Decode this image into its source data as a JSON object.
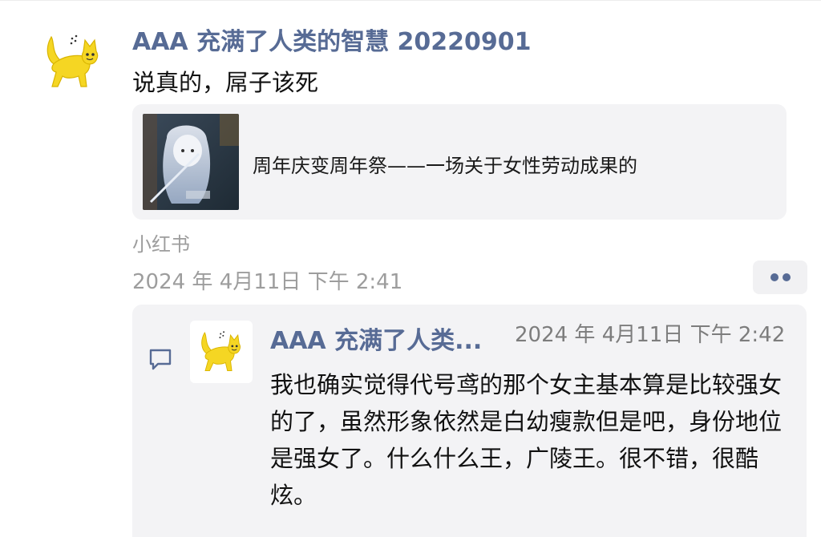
{
  "post": {
    "author": "AAA 充满了人类的智慧 20220901",
    "text": "说真的，屌子该死",
    "share": {
      "title": "周年庆变周年祭——一场关于女性劳动成果的",
      "source": "小红书"
    },
    "timestamp": "2024 年 4月11日 下午 2:41"
  },
  "comment": {
    "author": "AAA 充满了人类...",
    "time": "2024 年 4月11日 下午 2:42",
    "text": "我也确实觉得代号鸢的那个女主基本算是比较强女的了，虽然形象依然是白幼瘦款但是吧，身份地位是强女了。什么什么王，广陵王。很不错，很酷炫。"
  },
  "icons": {
    "avatar": "yellow-cat-icon",
    "more": "more-dots-icon",
    "comment": "comment-bubble-icon"
  },
  "colors": {
    "link_blue": "#576b95",
    "avatar_yellow": "#f5d623",
    "card_bg": "#f3f3f5",
    "meta_gray": "#9d9d9d"
  }
}
